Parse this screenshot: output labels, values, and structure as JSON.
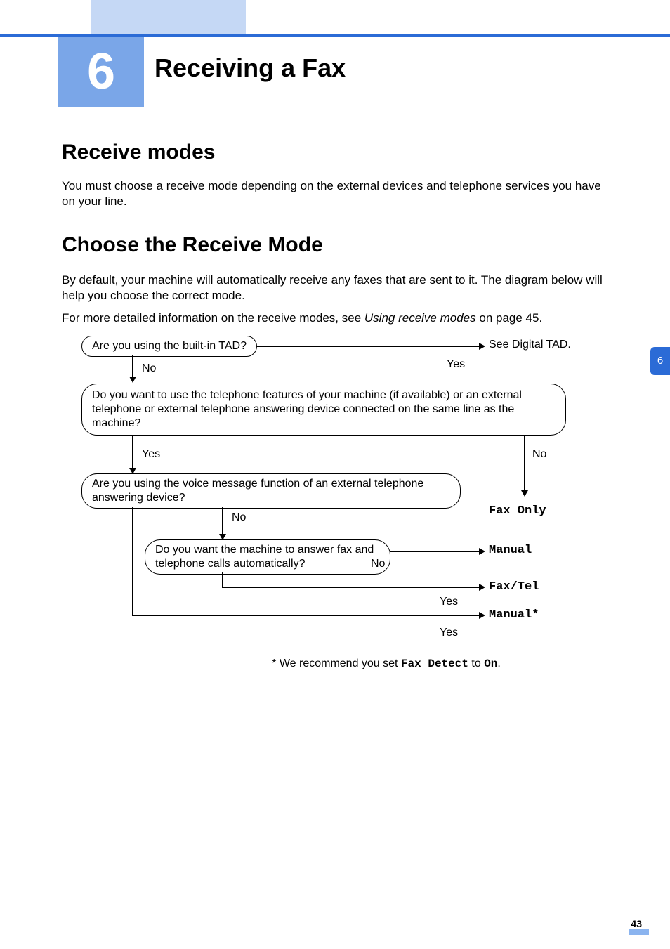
{
  "chapter": {
    "number": "6",
    "title": "Receiving a Fax"
  },
  "section1": {
    "heading": "Receive modes",
    "p1": "You must choose a receive mode depending on the external devices and telephone services you have on your line."
  },
  "section2": {
    "heading": "Choose the Receive Mode",
    "p1": "By default, your machine will automatically receive any faxes that are sent to it. The diagram below will help you choose the correct mode.",
    "p2_a": "For more detailed information on the receive modes, see ",
    "p2_i": "Using receive modes",
    "p2_b": " on page 45."
  },
  "chart_data": {
    "type": "flowchart",
    "nodes": [
      {
        "id": "q1",
        "text": "Are you using the built-in TAD?",
        "yes": "r_tad",
        "no": "q2"
      },
      {
        "id": "q2",
        "text": "Do you want to use the telephone features of your machine (if available) or an external telephone or external telephone answering device connected on the same line as the machine?",
        "yes": "q3",
        "no": "r_faxonly"
      },
      {
        "id": "q3",
        "text": "Are you using the voice message function of an external telephone answering device?",
        "yes": "r_manual_star",
        "no": "q4"
      },
      {
        "id": "q4",
        "text": "Do you want the machine to answer fax and telephone calls automatically?",
        "yes": "r_faxtel",
        "no": "r_manual"
      }
    ],
    "results": {
      "r_tad": "See Digital TAD.",
      "r_faxonly": "Fax Only",
      "r_manual": "Manual",
      "r_faxtel": "Fax/Tel",
      "r_manual_star": "Manual*"
    },
    "labels": {
      "yes": "Yes",
      "no": "No"
    },
    "footnote_a": "* We recommend you set ",
    "footnote_m1": "Fax Detect",
    "footnote_b": " to ",
    "footnote_m2": "On",
    "footnote_c": "."
  },
  "sidetab": "6",
  "page": "43"
}
